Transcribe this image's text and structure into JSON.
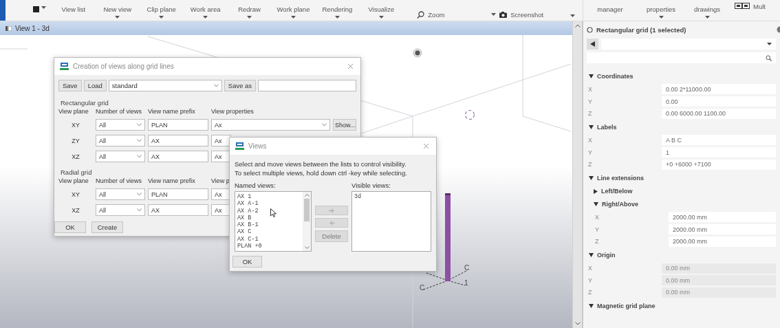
{
  "toolbar": {
    "items": [
      {
        "kind": "logo",
        "caret": true
      },
      {
        "kind": "text",
        "label": "View list",
        "caret": false
      },
      {
        "kind": "text",
        "label": "New view",
        "caret": true
      },
      {
        "kind": "text",
        "label": "Clip plane",
        "caret": true
      },
      {
        "kind": "text",
        "label": "Work area",
        "caret": true
      },
      {
        "kind": "text",
        "label": "Redraw",
        "caret": true
      },
      {
        "kind": "text",
        "label": "Work plane",
        "caret": true
      },
      {
        "kind": "text",
        "label": "Rendering",
        "caret": true
      },
      {
        "kind": "text",
        "label": "Visualize",
        "caret": true
      },
      {
        "kind": "zoom",
        "label": "Zoom",
        "caret": false
      },
      {
        "kind": "camera",
        "label": "Screenshot",
        "caret": true
      },
      {
        "kind": "overflow",
        "caret": true
      }
    ],
    "panel_items": [
      {
        "kind": "text",
        "label": "manager",
        "caret": false
      },
      {
        "kind": "text",
        "label": "properties",
        "caret": true
      },
      {
        "kind": "text",
        "label": "drawings",
        "caret": true
      },
      {
        "kind": "mult",
        "label": "Mult",
        "caret": false
      }
    ]
  },
  "view": {
    "title": "View 1 - 3d",
    "labels": [
      "C",
      "C",
      "1"
    ]
  },
  "grid_dialog": {
    "title": "Creation of views along grid lines",
    "save": "Save",
    "load": "Load",
    "preset": "standard",
    "save_as": "Save as",
    "sections": [
      {
        "title": "Rectangular grid",
        "headers": [
          "View plane",
          "Number of views",
          "View name prefix",
          "View properties"
        ],
        "rows": [
          {
            "plane": "XY",
            "count": "All",
            "prefix": "PLAN",
            "properties": "Ax",
            "show": "Show..."
          },
          {
            "plane": "ZY",
            "count": "All",
            "prefix": "AX",
            "properties": "Ax"
          },
          {
            "plane": "XZ",
            "count": "All",
            "prefix": "AX",
            "properties": "Ax"
          }
        ]
      },
      {
        "title": "Radial grid",
        "headers": [
          "View plane",
          "Number of views",
          "View name prefix",
          "View p"
        ],
        "rows": [
          {
            "plane": "XY",
            "count": "All",
            "prefix": "PLAN",
            "properties": "Ax"
          },
          {
            "plane": "XZ",
            "count": "All",
            "prefix": "AX",
            "properties": "Ax"
          }
        ]
      }
    ],
    "buttons": [
      "OK",
      "Create"
    ]
  },
  "views_dialog": {
    "title": "Views",
    "instructions": [
      "Select and move views between the lists to control visibility.",
      "To select multiple views, hold down ctrl -key while selecting."
    ],
    "named_label": "Named views:",
    "named_views": [
      {
        "label": "AX 1",
        "selected": false
      },
      {
        "label": "AX A-1",
        "selected": false
      },
      {
        "label": "AX A-2",
        "selected": false
      },
      {
        "label": "AX B",
        "selected": false
      },
      {
        "label": "AX B-1",
        "selected": false
      },
      {
        "label": "AX C",
        "selected": false
      },
      {
        "label": "AX C-1",
        "selected": false
      },
      {
        "label": "PLAN +0",
        "selected": false
      }
    ],
    "visible_label": "Visible views:",
    "visible_views": [
      {
        "label": "3d",
        "selected": false
      }
    ],
    "move_buttons": [
      {
        "kind": "right",
        "disabled": true
      },
      {
        "kind": "left",
        "disabled": true
      },
      {
        "kind": "text",
        "label": "Delete",
        "disabled": true
      }
    ],
    "ok": "OK"
  },
  "panel": {
    "title": "Rectangular grid (1 selected)",
    "sections": [
      {
        "title": "Coordinates",
        "expanded": true,
        "rows": [
          {
            "label": "X",
            "value": "0.00 2*11000.00",
            "disabled": false
          },
          {
            "label": "Y",
            "value": "0.00",
            "disabled": false
          },
          {
            "label": "Z",
            "value": "0.00 6000.00 1100.00",
            "disabled": false
          }
        ]
      },
      {
        "title": "Labels",
        "expanded": true,
        "rows": [
          {
            "label": "X",
            "value": "A B C",
            "disabled": false
          },
          {
            "label": "Y",
            "value": "1",
            "disabled": false
          },
          {
            "label": "Z",
            "value": "+0 +6000 +7100",
            "disabled": false
          }
        ]
      },
      {
        "title": "Line extensions",
        "expanded": true,
        "children": [
          {
            "title": "Left/Below",
            "expanded": false
          },
          {
            "title": "Right/Above",
            "expanded": true,
            "rows": [
              {
                "label": "X",
                "value": "2000.00 mm",
                "disabled": false
              },
              {
                "label": "Y",
                "value": "2000.00 mm",
                "disabled": false
              },
              {
                "label": "Z",
                "value": "2000.00 mm",
                "disabled": false
              }
            ]
          }
        ]
      },
      {
        "title": "Origin",
        "expanded": true,
        "rows": [
          {
            "label": "X",
            "value": "0.00 mm",
            "disabled": true
          },
          {
            "label": "Y",
            "value": "0.00 mm",
            "disabled": true
          },
          {
            "label": "Z",
            "value": "0.00 mm",
            "disabled": true
          }
        ]
      },
      {
        "title": "Magnetic grid plane",
        "expanded": true
      }
    ]
  }
}
